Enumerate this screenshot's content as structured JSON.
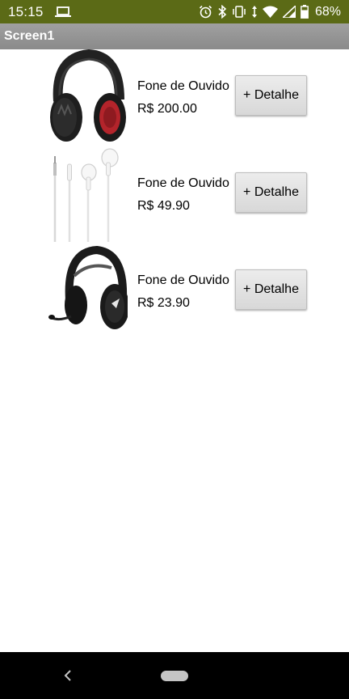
{
  "status_bar": {
    "time": "15:15",
    "battery": "68%",
    "icons": [
      "laptop-icon",
      "alarm-icon",
      "bluetooth-icon",
      "vibrate-icon",
      "data-arrows-icon",
      "wifi-icon",
      "signal-icon",
      "battery-icon"
    ]
  },
  "title_bar": {
    "title": "Screen1"
  },
  "products": [
    {
      "name": "Fone de Ouvido",
      "price": "R$ 200.00",
      "button": "+ Detalhe",
      "image": "wireless-headphones-red"
    },
    {
      "name": "Fone de Ouvido",
      "price": "R$ 49.90",
      "button": "+ Detalhe",
      "image": "white-earbuds"
    },
    {
      "name": "Fone de Ouvido",
      "price": "R$ 23.90",
      "button": "+ Detalhe",
      "image": "headset-with-mic"
    }
  ],
  "nav_bar": {
    "icons": [
      "back-icon",
      "home-pill-icon"
    ]
  },
  "colors": {
    "status_bar": "#5b6a16",
    "title_bar": "#959595",
    "nav_bar": "#000000",
    "button": "#e0e0e0"
  }
}
